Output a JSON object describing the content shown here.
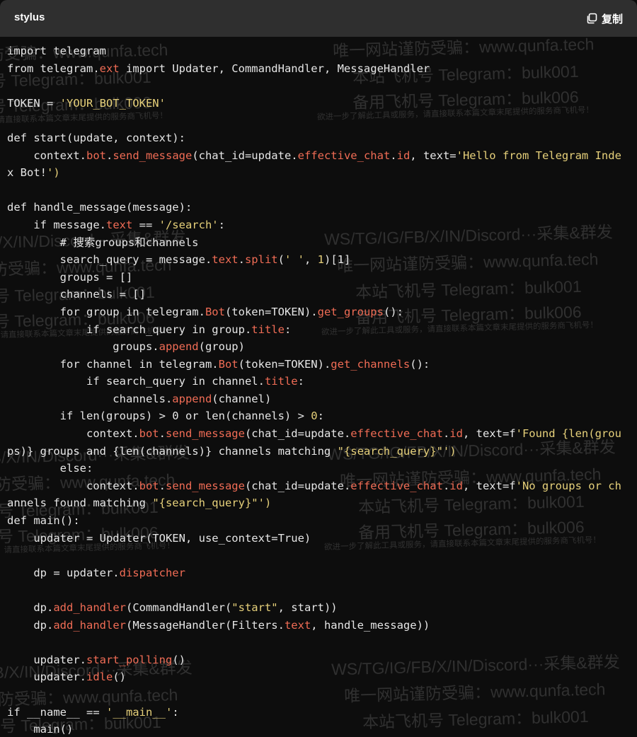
{
  "header": {
    "language": "stylus",
    "copy_label": "复制",
    "copy_icon": "copy-icon"
  },
  "colors": {
    "header_bg": "#2f2f2f",
    "code_bg": "#0d0d0d",
    "text": "#e6e6e6",
    "attribute": "#f06c55",
    "string": "#e6d07a"
  },
  "code_lines": [
    "import telegram",
    "from telegram.ext import Updater, CommandHandler, MessageHandler",
    "",
    "TOKEN = 'YOUR_BOT_TOKEN'",
    "",
    "def start(update, context):",
    "    context.bot.send_message(chat_id=update.effective_chat.id, text='Hello from Telegram Inde",
    "x Bot!')",
    "",
    "def handle_message(message):",
    "    if message.text == '/search':",
    "        # 搜索groups和channels",
    "        search_query = message.text.split(' ', 1)[1]",
    "        groups = []",
    "        channels = []",
    "        for group in telegram.Bot(token=TOKEN).get_groups():",
    "            if search_query in group.title:",
    "                groups.append(group)",
    "        for channel in telegram.Bot(token=TOKEN).get_channels():",
    "            if search_query in channel.title:",
    "                channels.append(channel)",
    "        if len(groups) > 0 or len(channels) > 0:",
    "            context.bot.send_message(chat_id=update.effective_chat.id, text=f'Found {len(grou",
    "ps)} groups and {len(channels)} channels matching \"{search_query}\"')",
    "        else:",
    "            context.bot.send_message(chat_id=update.effective_chat.id, text=f'No groups or ch",
    "annels found matching \"{search_query}\"')",
    "def main():",
    "    updater = Updater(TOKEN, use_context=True)",
    "",
    "    dp = updater.dispatcher",
    "",
    "    dp.add_handler(CommandHandler(\"start\", start))",
    "    dp.add_handler(MessageHandler(Filters.text, handle_message))",
    "",
    "    updater.start_polling()",
    "    updater.idle()",
    "",
    "if __name__ == '__main__':",
    "    main()"
  ],
  "watermark": {
    "line1": "WS/TG/IG/FB/X/IN/Discord···采集&群发",
    "line2": "唯一网站谨防受骗：www.qunfa.tech",
    "line3": "本站飞机号 Telegram：bulk001",
    "line4": "备用飞机号 Telegram：bulk006",
    "line5": "欲进一步了解此工具或服务，请直接联系本篇文章末尾提供的服务商飞机号！"
  }
}
